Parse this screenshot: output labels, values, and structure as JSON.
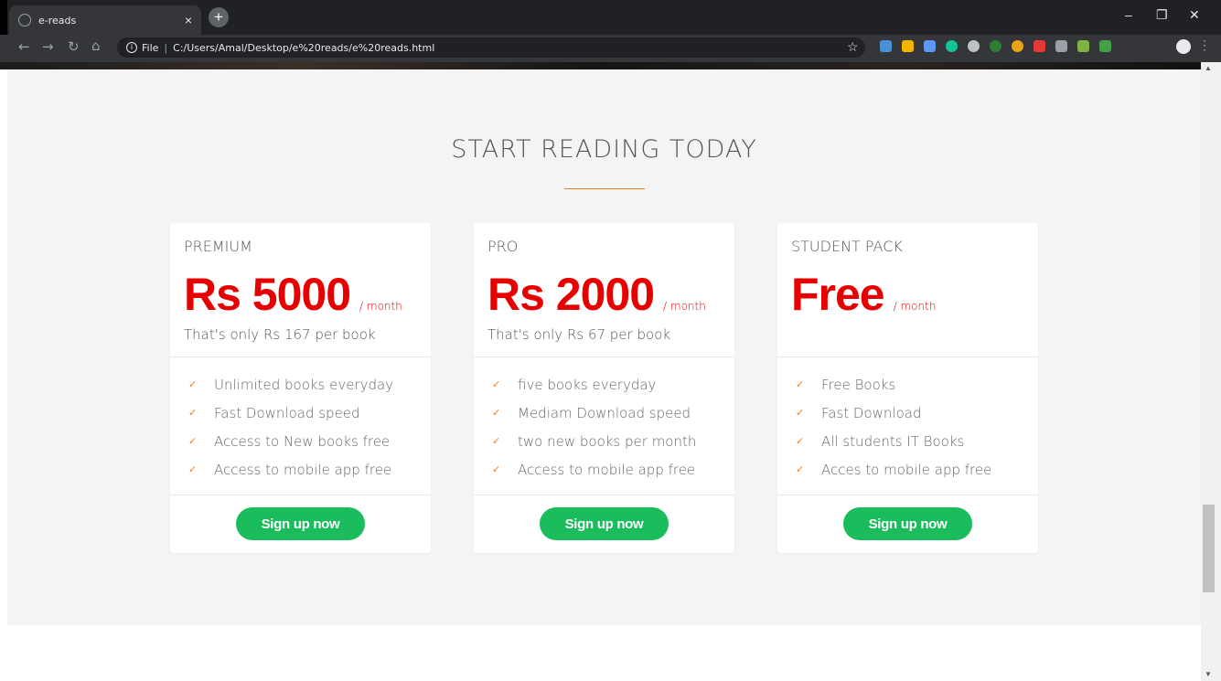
{
  "browser": {
    "tab_title": "e-reads",
    "tab_close": "×",
    "new_tab": "+",
    "file_label": "File",
    "url": "C:/Users/Amal/Desktop/e%20reads/e%20reads.html",
    "window_minimize": "–",
    "window_restore": "❐",
    "window_close": "✕"
  },
  "section": {
    "title": "START READING TODAY"
  },
  "plans": [
    {
      "name": "PREMIUM",
      "price": "Rs 5000",
      "per": "/ month",
      "note": "That's only Rs 167 per book",
      "features": [
        "Unlimited books everyday",
        "Fast Download speed",
        "Access to New books free",
        "Access to mobile app free"
      ],
      "button": "Sign up now"
    },
    {
      "name": "PRO",
      "price": "Rs 2000",
      "per": "/ month",
      "note": "That's only Rs 67 per book",
      "features": [
        "five books everyday",
        "Mediam Download speed",
        "two new books per month",
        "Access to mobile app free"
      ],
      "button": "Sign up now"
    },
    {
      "name": "STUDENT PACK",
      "price": "Free",
      "per": "/ month",
      "note": "",
      "features": [
        "Free Books",
        "Fast Download",
        "All students IT Books",
        "Acces to mobile app free"
      ],
      "button": "Sign up now"
    }
  ],
  "colors": {
    "accent": "#e67e22",
    "price": "#e60000",
    "button": "#1abc5c",
    "background": "#f4f4f4"
  }
}
